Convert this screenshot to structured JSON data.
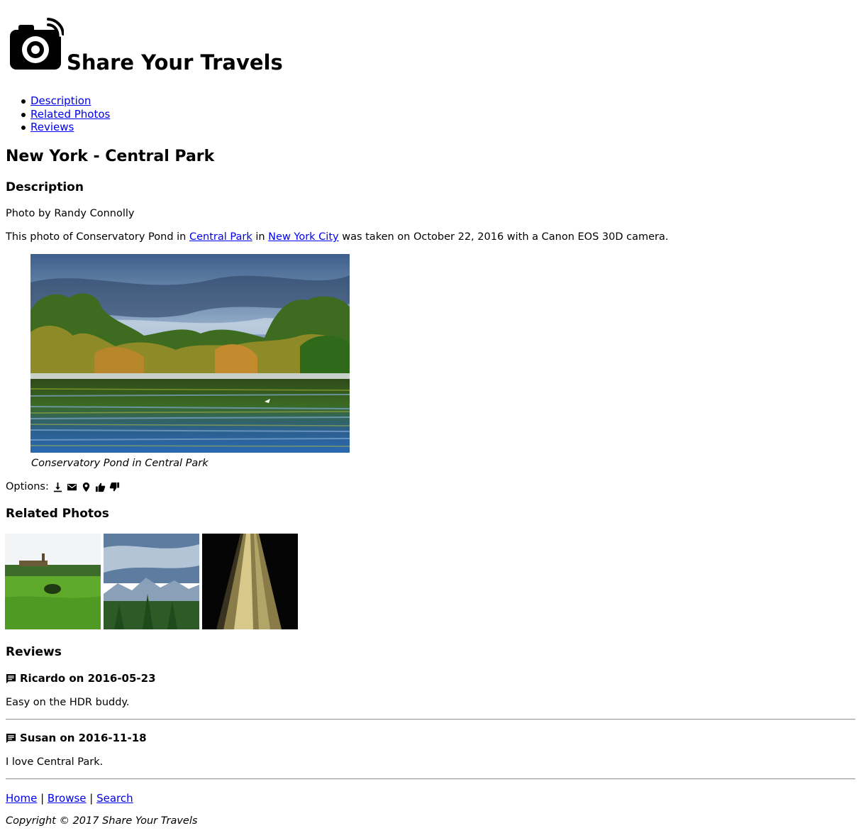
{
  "header": {
    "site_title": "Share Your Travels",
    "logo_icon": "camera-wifi-icon"
  },
  "nav": {
    "items": [
      {
        "label": "Description"
      },
      {
        "label": "Related Photos"
      },
      {
        "label": "Reviews"
      }
    ]
  },
  "photo": {
    "title": "New York - Central Park",
    "description_heading": "Description",
    "byline": "Photo by Randy Connolly",
    "desc_pre": "This photo of Conservatory Pond in ",
    "link_park": "Central Park",
    "desc_mid": " in ",
    "link_city": "New York City",
    "desc_post": " was taken on October 22, 2016 with a Canon EOS 30D camera.",
    "caption": "Conservatory Pond in Central Park",
    "alt": "Conservatory Pond in Central Park"
  },
  "options": {
    "label": "Options:",
    "icons": [
      "download-icon",
      "email-icon",
      "map-marker-icon",
      "thumbs-up-icon",
      "thumbs-down-icon"
    ]
  },
  "related": {
    "heading": "Related Photos"
  },
  "reviews": {
    "heading": "Reviews",
    "items": [
      {
        "author_line": "Ricardo on 2016-05-23",
        "text": "Easy on the HDR buddy."
      },
      {
        "author_line": "Susan on 2016-11-18",
        "text": "I love Central Park."
      }
    ]
  },
  "footer": {
    "home": "Home",
    "browse": "Browse",
    "search": "Search",
    "sep": " | ",
    "copyright": "Copyright © 2017 Share Your Travels"
  },
  "colors": {
    "link": "#0000ee",
    "text": "#000000",
    "rule": "#9a9a9a"
  }
}
